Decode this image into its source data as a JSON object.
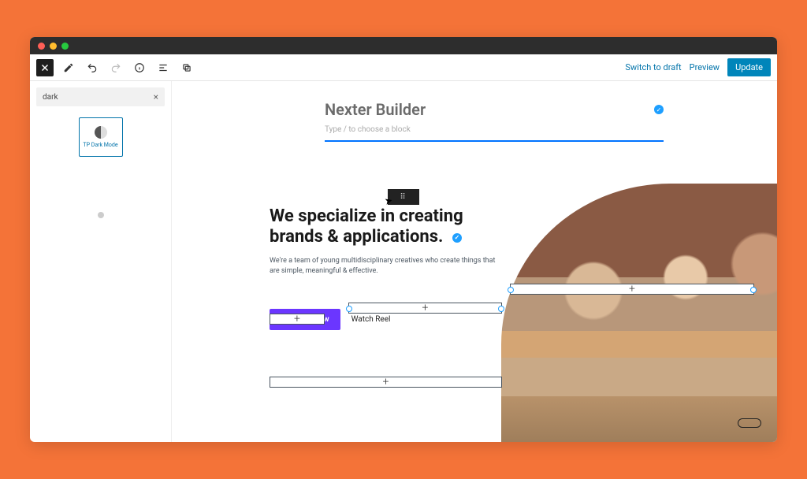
{
  "toolbar": {
    "switch_draft": "Switch to draft",
    "preview": "Preview",
    "update": "Update"
  },
  "sidebar": {
    "search_value": "dark",
    "block_tile_label": "TP Dark Mode"
  },
  "editor": {
    "title": "Nexter Builder",
    "prompt": "Type / to choose a block"
  },
  "hero": {
    "heading_line1": "We specialize in creating",
    "heading_line2": "brands & applications.",
    "subtext": "We're a team of young multidisciplinary creatives who create things that are simple, meaningful & effective.",
    "cta_primary": "Discover Now",
    "cta_secondary": "Watch Reel"
  },
  "slots": {
    "plus": "+"
  }
}
